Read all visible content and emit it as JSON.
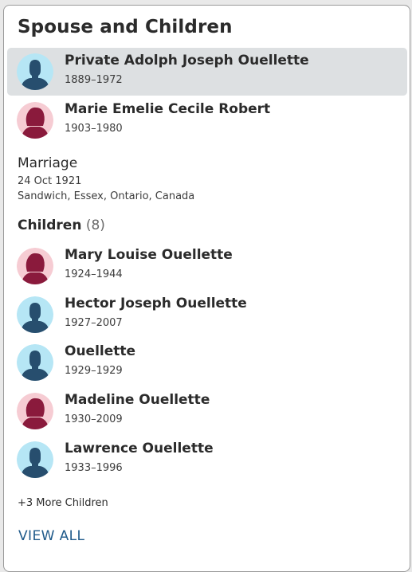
{
  "section_title": "Spouse and Children",
  "spouses": [
    {
      "name": "Private Adolph Joseph Ouellette",
      "dates": "1889–1972",
      "gender": "male",
      "selected": true
    },
    {
      "name": "Marie Emelie Cecile Robert",
      "dates": "1903–1980",
      "gender": "female",
      "selected": false
    }
  ],
  "marriage": {
    "label": "Marriage",
    "date": "24 Oct 1921",
    "place": "Sandwich, Essex, Ontario, Canada"
  },
  "children_header": {
    "label": "Children",
    "count": "(8)"
  },
  "children": [
    {
      "name": "Mary Louise Ouellette",
      "dates": "1924–1944",
      "gender": "female"
    },
    {
      "name": "Hector Joseph Ouellette",
      "dates": "1927–2007",
      "gender": "male"
    },
    {
      "name": "Ouellette",
      "dates": "1929–1929",
      "gender": "male"
    },
    {
      "name": "Madeline Ouellette",
      "dates": "1930–2009",
      "gender": "female"
    },
    {
      "name": "Lawrence Ouellette",
      "dates": "1933–1996",
      "gender": "male"
    }
  ],
  "more_children": "+3 More Children",
  "view_all": "VIEW ALL",
  "colors": {
    "male_bg": "#b6e6f5",
    "male_fg": "#274e6e",
    "female_bg": "#f6ccd3",
    "female_fg": "#8a1a3c",
    "selected_bg": "#dde0e2",
    "link": "#1f5a8a"
  }
}
